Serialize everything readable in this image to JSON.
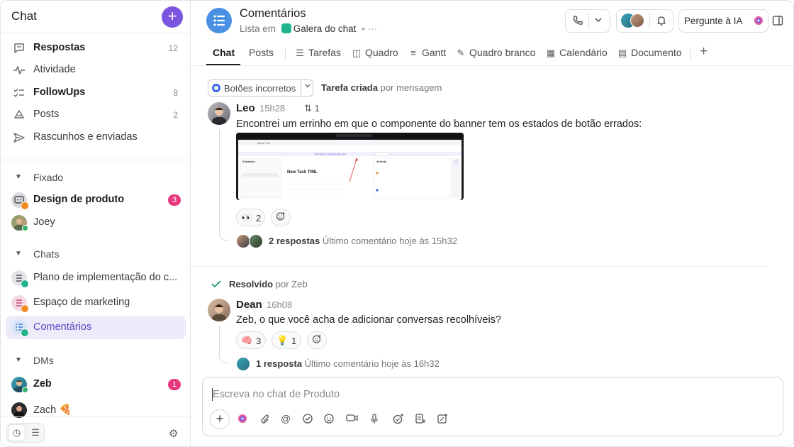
{
  "sidebar": {
    "title": "Chat",
    "add_label": "+",
    "top_items": [
      {
        "label": "Respostas",
        "count": "12",
        "icon": "chat-bubble-icon",
        "glyph": "💬"
      },
      {
        "label": "Atividade",
        "count": "",
        "icon": "activity-pulse-icon",
        "glyph": "∿"
      },
      {
        "label": "FollowUps",
        "count": "8",
        "icon": "checklist-icon",
        "glyph": "☑"
      },
      {
        "label": "Posts",
        "count": "2",
        "icon": "megaphone-icon",
        "glyph": "◁"
      },
      {
        "label": "Rascunhos e enviadas",
        "count": "",
        "icon": "send-icon",
        "glyph": "➤"
      }
    ],
    "sections": {
      "fixado": "Fixado",
      "chats": "Chats",
      "dms": "DMs"
    },
    "pinned": [
      {
        "label": "Design de produto",
        "badge": "3"
      },
      {
        "label": "Joey"
      }
    ],
    "chats": [
      {
        "label": "Plano de implementação do c..."
      },
      {
        "label": "Espaço de marketing"
      },
      {
        "label": "Comentários"
      }
    ],
    "dms": [
      {
        "label": "Zeb",
        "badge": "1"
      },
      {
        "label": "Zach 🍕"
      }
    ]
  },
  "header": {
    "title": "Comentários",
    "list_in": "Lista em",
    "space": "Galera do chat",
    "ai_button": "Pergunte à IA"
  },
  "tabs": [
    {
      "label": "Chat",
      "icon": ""
    },
    {
      "label": "Posts",
      "icon": ""
    },
    {
      "label": "Tarefas",
      "icon": "list-icon",
      "glyph": "☰"
    },
    {
      "label": "Quadro",
      "icon": "board-icon",
      "glyph": "◫"
    },
    {
      "label": "Gantt",
      "icon": "gantt-icon",
      "glyph": "≡"
    },
    {
      "label": "Quadro branco",
      "icon": "whiteboard-icon",
      "glyph": "✎"
    },
    {
      "label": "Calendário",
      "icon": "calendar-icon",
      "glyph": "▦"
    },
    {
      "label": "Documento",
      "icon": "document-icon",
      "glyph": "▤"
    }
  ],
  "thread1": {
    "status": "Botões incorretos",
    "created_bold": "Tarefa criada",
    "created_rest": "por mensagem",
    "author": "Leo",
    "time": "15h28",
    "assign_count": "1",
    "text": "Encontrei um errinho em que o componente do banner tem os estados de botão errados:",
    "reactions": [
      {
        "emoji": "👀",
        "count": "2"
      }
    ],
    "replies_bold": "2 respostas",
    "replies_rest": "Último comentário hoje às 15h32",
    "shot": {
      "breadcrumb": "Sprint / List",
      "banner": "This task is shared to the web",
      "panel": "Subtasks",
      "task_title": "New Task TIML",
      "activity": "Activity"
    }
  },
  "thread2": {
    "resolved_bold": "Resolvido",
    "resolved_rest": "por Zeb",
    "author": "Dean",
    "time": "16h08",
    "text": "Zeb, o que você acha de adicionar conversas recolhíveis?",
    "reactions": [
      {
        "emoji": "🧠",
        "count": "3"
      },
      {
        "emoji": "💡",
        "count": "1"
      }
    ],
    "replies_bold": "1 resposta",
    "replies_rest": "Último comentário hoje às 16h32"
  },
  "composer": {
    "placeholder": "Escreva no chat de Produto"
  },
  "colors": {
    "accent": "#7b55e0",
    "badge": "#e6397d",
    "active_bg": "#ecebf9",
    "status_blue": "#3c68e0"
  }
}
